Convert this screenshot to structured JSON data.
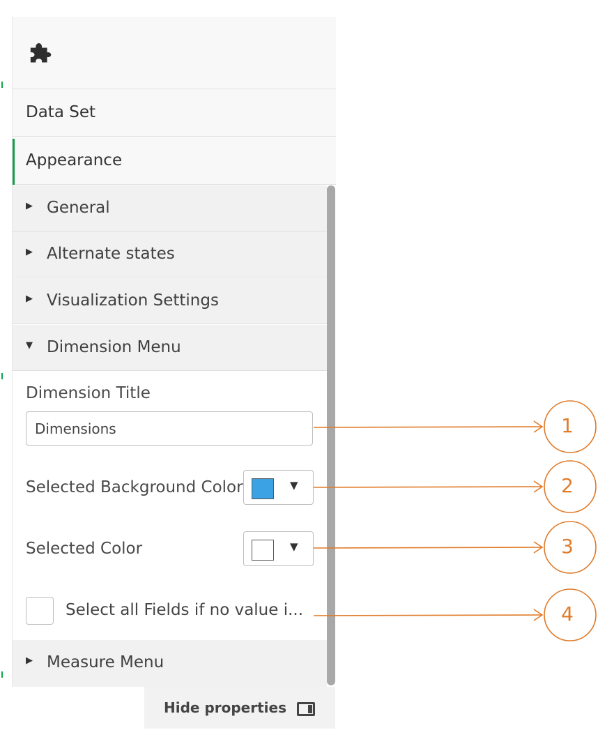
{
  "panel": {
    "header_icon": "puzzle-piece-icon",
    "tabs": [
      {
        "label": "Data Set",
        "active": false
      },
      {
        "label": "Appearance",
        "active": true
      }
    ],
    "sections": [
      {
        "label": "General",
        "expanded": false
      },
      {
        "label": "Alternate states",
        "expanded": false
      },
      {
        "label": "Visualization Settings",
        "expanded": false
      },
      {
        "label": "Dimension Menu",
        "expanded": true
      },
      {
        "label": "Measure Menu",
        "expanded": false
      }
    ],
    "dimension_menu": {
      "dimension_title_label": "Dimension Title",
      "dimension_title_value": "Dimensions",
      "selected_background_color_label": "Selected Background Color",
      "selected_background_color": "#3ba3e3",
      "selected_color_label": "Selected Color",
      "selected_color": "#ffffff",
      "select_all_checkbox_label": "Select all Fields if no value i...",
      "select_all_checked": false
    }
  },
  "footer": {
    "hide_properties_label": "Hide properties",
    "icon": "panel-toggle-icon"
  },
  "callouts": {
    "color": "#e07b2a",
    "numbers": [
      "1",
      "2",
      "3",
      "4"
    ]
  }
}
